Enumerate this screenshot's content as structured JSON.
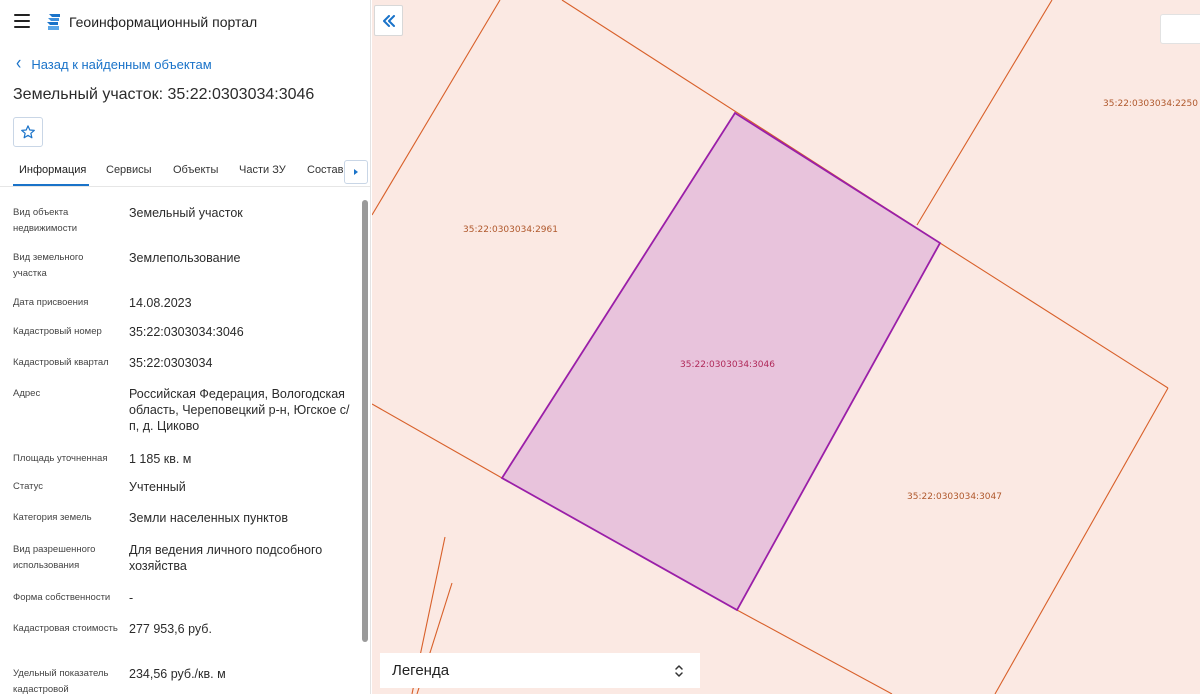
{
  "app": {
    "title": "Геоинформационный портал"
  },
  "nav": {
    "back_label": "Назад к найденным объектам"
  },
  "object": {
    "title": "Земельный участок: 35:22:0303034:3046"
  },
  "tabs": [
    {
      "label": "Информация",
      "active": true
    },
    {
      "label": "Сервисы",
      "active": false
    },
    {
      "label": "Объекты",
      "active": false
    },
    {
      "label": "Части ЗУ",
      "active": false
    },
    {
      "label": "Состав",
      "active": false
    }
  ],
  "properties": [
    {
      "label": "Вид объекта недвижимости",
      "value": "Земельный участок"
    },
    {
      "label": "Вид земельного участка",
      "value": "Землепользование"
    },
    {
      "label": "Дата присвоения",
      "value": "14.08.2023"
    },
    {
      "label": "Кадастровый номер",
      "value": "35:22:0303034:3046"
    },
    {
      "label": "Кадастровый квартал",
      "value": "35:22:0303034"
    },
    {
      "label": "Адрес",
      "value": "Российская Федерация, Вологодская область, Череповецкий р-н, Югское с/п, д. Циково"
    },
    {
      "label": "Площадь уточненная",
      "value": "1 185 кв. м"
    },
    {
      "label": "Статус",
      "value": "Учтенный"
    },
    {
      "label": "Категория земель",
      "value": "Земли населенных пунктов"
    },
    {
      "label": "Вид разрешенного использования",
      "value": "Для ведения личного подсобного хозяйства"
    },
    {
      "label": "Форма собственности",
      "value": "-"
    },
    {
      "label": "Кадастровая стоимость",
      "value": "277 953,6 руб."
    },
    {
      "label": "Удельный показатель кадастровой",
      "value": "234,56 руб./кв. м"
    }
  ],
  "map": {
    "parcel_labels": [
      "35:22:0303034:2250",
      "35:22:0303034:2961",
      "35:22:0303034:3046",
      "35:22:0303034:3047"
    ],
    "colors": {
      "background": "#fbe9e3",
      "boundary": "#d8602a",
      "selected_fill": "#e8c3dc",
      "selected_stroke": "#9a1fa8",
      "label": "#b0592d",
      "selected_label": "#b02a5a"
    }
  },
  "legend": {
    "label": "Легенда"
  },
  "icons": {
    "menu": "hamburger-icon",
    "logo": "portal-logo-icon",
    "back": "chevron-left-icon",
    "favorite": "star-outline-icon",
    "tabs_next": "caret-right-icon",
    "collapse": "double-chevron-left-icon",
    "legend_toggle": "chevron-up-down-icon"
  }
}
